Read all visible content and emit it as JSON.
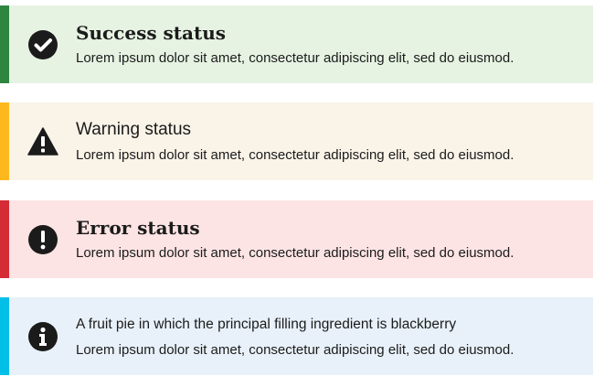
{
  "alerts": [
    {
      "type": "success",
      "icon": "check-circle-icon",
      "heading": "Success status",
      "text": "Lorem ipsum dolor sit amet, consectetur adipiscing elit, sed do eiusmod.",
      "accent_color": "#2e8540",
      "background_color": "#e6f3e2"
    },
    {
      "type": "warning",
      "icon": "warning-triangle-icon",
      "heading": "Warning status",
      "text": "Lorem ipsum dolor sit amet, consectetur adipiscing elit, sed do eiusmod.",
      "accent_color": "#fdb81e",
      "background_color": "#faf3e8"
    },
    {
      "type": "error",
      "icon": "exclamation-circle-icon",
      "heading": "Error status",
      "text": "Lorem ipsum dolor sit amet, consectetur adipiscing elit, sed do eiusmod.",
      "accent_color": "#d52b34",
      "background_color": "#fde4e4"
    },
    {
      "type": "info",
      "icon": "info-circle-icon",
      "heading": "A fruit pie in which the principal filling ingredient is blackberry",
      "text": "Lorem ipsum dolor sit amet, consectetur adipiscing elit, sed do eiusmod.",
      "accent_color": "#02bfe7",
      "background_color": "#e8f1f9"
    }
  ]
}
